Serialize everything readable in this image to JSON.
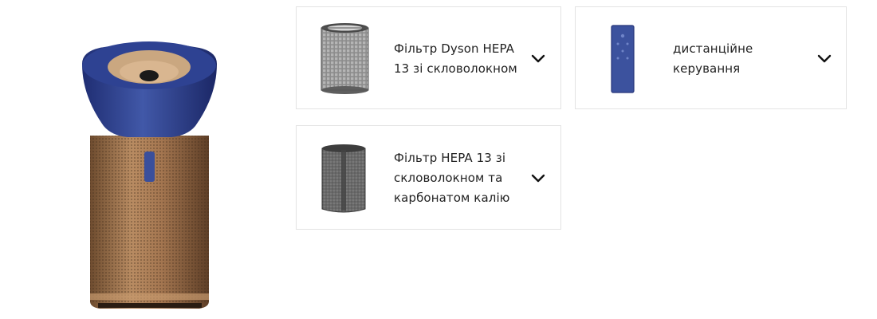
{
  "accessories": [
    {
      "name": "card-hepa-glass",
      "label": "Фільтр Dyson HEPA 13 зі скловолокном",
      "lines": [
        "Фільтр Dyson HEPA",
        "13 зі скловолокном"
      ]
    },
    {
      "name": "card-remote",
      "label": "дистанційне керування",
      "lines": [
        "дистанційне",
        "керування"
      ]
    },
    {
      "name": "card-hepa-carbon",
      "label": "Фільтр HEPA 13 зі скловолокном та карбонатом калію",
      "lines": [
        "Фільтр HEPA 13 зі",
        "скловолокном та",
        "карбонатом калію"
      ]
    }
  ],
  "icons": {
    "expand": "chevron-down-icon"
  },
  "colors": {
    "purifier_blue": "#3a4f9c",
    "purifier_copper": "#a87b52",
    "text": "#222222",
    "border": "#e3e3e3"
  }
}
